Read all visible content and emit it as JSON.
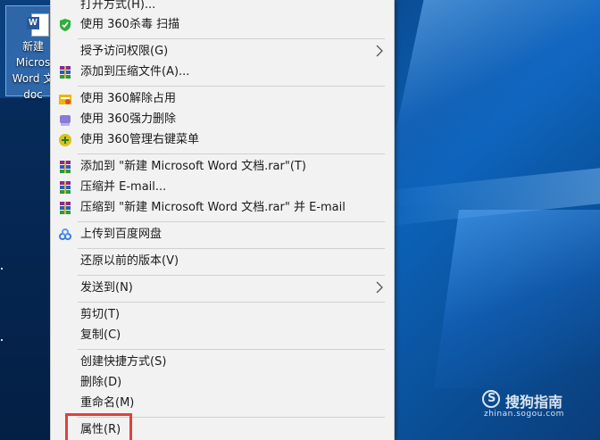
{
  "desktop": {
    "icon_label_lines": [
      "新建",
      "Micros",
      "Word 文",
      "doc"
    ],
    "icon_name": "word-document-icon"
  },
  "menu": {
    "items": [
      {
        "label": "打开方式(H)...",
        "icon": "none"
      },
      {
        "label": "使用 360杀毒 扫描",
        "icon": "shield-icon"
      },
      {
        "label": "授予访问权限(G)",
        "icon": "none",
        "submenu": true
      },
      {
        "label": "添加到压缩文件(A)...",
        "icon": "winrar-icon"
      },
      {
        "label": "使用 360解除占用",
        "icon": "unlock-icon"
      },
      {
        "label": "使用 360强力删除",
        "icon": "shred-icon"
      },
      {
        "label": "使用 360管理右键菜单",
        "icon": "plus-circle-icon"
      },
      {
        "label": "添加到 \"新建 Microsoft Word 文档.rar\"(T)",
        "icon": "winrar-icon"
      },
      {
        "label": "压缩并 E-mail...",
        "icon": "winrar-icon"
      },
      {
        "label": "压缩到 \"新建 Microsoft Word 文档.rar\" 并 E-mail",
        "icon": "winrar-icon"
      },
      {
        "label": "上传到百度网盘",
        "icon": "baidu-cloud-icon"
      },
      {
        "label": "还原以前的版本(V)",
        "icon": "none"
      },
      {
        "label": "发送到(N)",
        "icon": "none",
        "submenu": true
      },
      {
        "label": "剪切(T)",
        "icon": "none"
      },
      {
        "label": "复制(C)",
        "icon": "none"
      },
      {
        "label": "创建快捷方式(S)",
        "icon": "none"
      },
      {
        "label": "删除(D)",
        "icon": "none"
      },
      {
        "label": "重命名(M)",
        "icon": "none"
      },
      {
        "label": "属性(R)",
        "icon": "none"
      }
    ]
  },
  "watermark": {
    "brand": "搜狗指南",
    "url": "zhinan.sogou.com"
  },
  "colors": {
    "menu_bg": "#f2f2f2",
    "highlight_border": "#e0403a",
    "desktop_bg": "#0a4a90"
  }
}
